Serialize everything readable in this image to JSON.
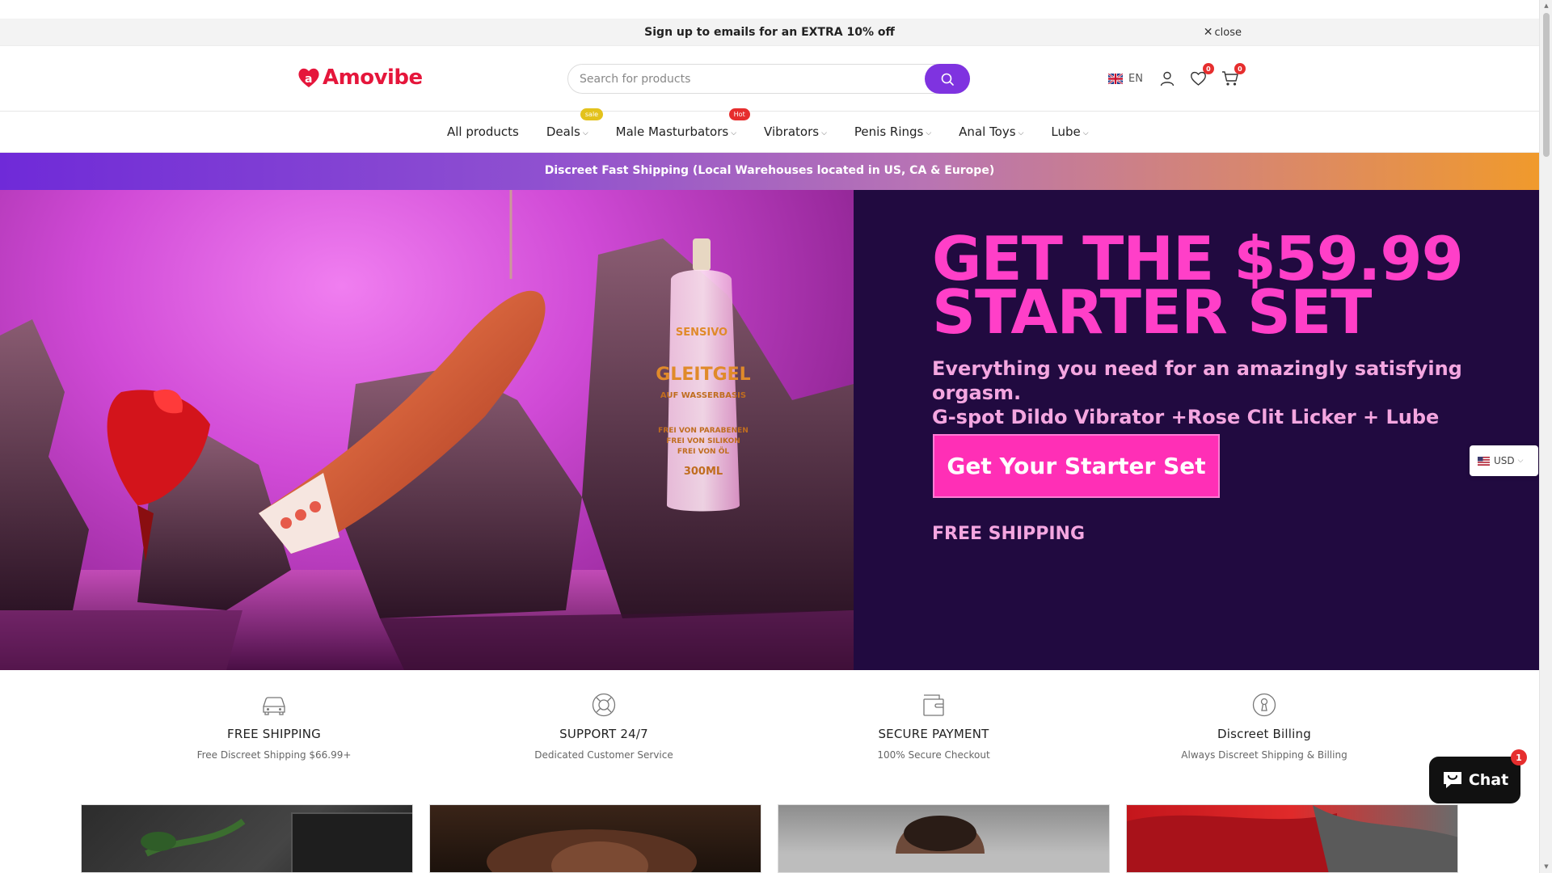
{
  "announcement": {
    "text": "Sign up to emails for an EXTRA 10% off",
    "close_label": "close"
  },
  "header": {
    "logo_text": "Amovibe",
    "search_placeholder": "Search for products",
    "language": "EN",
    "wishlist_count": "0",
    "cart_count": "0"
  },
  "nav": {
    "items": [
      {
        "label": "All products",
        "dropdown": false
      },
      {
        "label": "Deals",
        "dropdown": true,
        "tag": "sale"
      },
      {
        "label": "Male Masturbators",
        "dropdown": true,
        "tag": "Hot"
      },
      {
        "label": "Vibrators",
        "dropdown": true
      },
      {
        "label": "Penis Rings",
        "dropdown": true
      },
      {
        "label": "Anal Toys",
        "dropdown": true
      },
      {
        "label": "Lube",
        "dropdown": true
      }
    ]
  },
  "shipping_banner": "Discreet Fast Shipping (Local Warehouses located in US, CA & Europe)",
  "hero": {
    "title_line1": "GET THE $59.99",
    "title_line2": "STARTER SET",
    "subtitle_line1": "Everything you need for an amazingly satisfying orgasm.",
    "subtitle_line2": "G-spot Dildo Vibrator +Rose Clit Licker + Lube",
    "cta": "Get Your Starter Set",
    "free_shipping": "FREE SHIPPING",
    "bottle_brand": "SENSIVO",
    "bottle_name": "GLEITGEL",
    "bottle_sub": "AUF WASSERBASIS",
    "bottle_lines": [
      "FREI VON PARABENEN",
      "FREI VON SILIKON",
      "FREI VON ÖL"
    ],
    "bottle_volume": "300ML"
  },
  "currency": "USD",
  "features": [
    {
      "icon": "car-icon",
      "title": "FREE SHIPPING",
      "desc": "Free Discreet Shipping $66.99+"
    },
    {
      "icon": "lifebuoy-icon",
      "title": "SUPPORT 24/7",
      "desc": "Dedicated Customer Service"
    },
    {
      "icon": "wallet-icon",
      "title": "SECURE PAYMENT",
      "desc": "100% Secure Checkout"
    },
    {
      "icon": "keyhole-icon",
      "title": "Discreet Billing",
      "desc": "Always Discreet Shipping & Billing"
    }
  ],
  "chat": {
    "label": "Chat",
    "badge": "1"
  },
  "colors": {
    "brand_red": "#e5163b",
    "accent_purple": "#7f33e0",
    "hero_pink": "#ff3fc8",
    "hero_bg": "#210a40",
    "cta_pink": "#ff2fb6"
  }
}
